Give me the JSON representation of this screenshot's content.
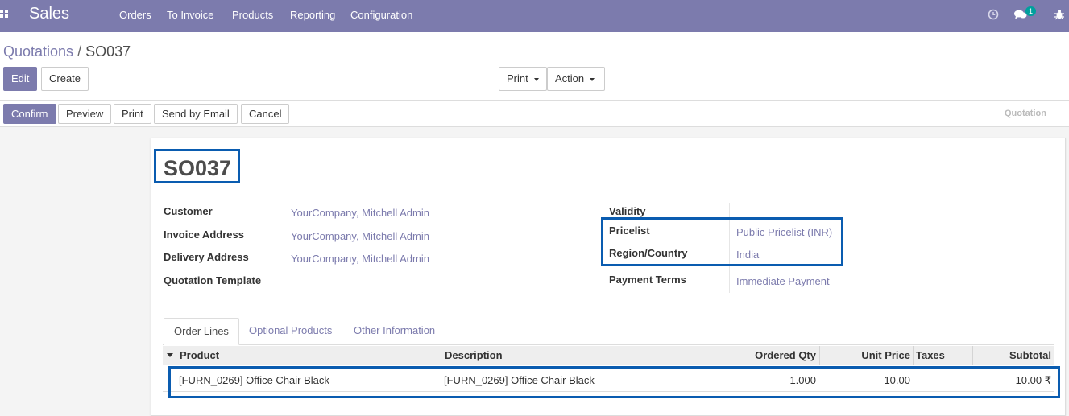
{
  "navbar": {
    "app_name": "Sales",
    "menu": [
      "Orders",
      "To Invoice",
      "Products",
      "Reporting",
      "Configuration"
    ],
    "icons": [
      "apps-grid-icon",
      "clock-icon",
      "chat-icon",
      "bug-icon"
    ],
    "chat_badge": "1",
    "color": "#7c7bad"
  },
  "breadcrumb": {
    "parent": "Quotations",
    "separator": "/",
    "current": "SO037"
  },
  "control_panel": {
    "edit": "Edit",
    "create": "Create",
    "print": "Print",
    "action": "Action"
  },
  "statusbar": {
    "buttons": [
      "Confirm",
      "Preview",
      "Print",
      "Send by Email",
      "Cancel"
    ],
    "stage": "Quotation"
  },
  "form": {
    "name": "SO037",
    "left": {
      "customer_label": "Customer",
      "customer_value": "YourCompany, Mitchell Admin",
      "invoice_label": "Invoice Address",
      "invoice_value": "YourCompany, Mitchell Admin",
      "delivery_label": "Delivery Address",
      "delivery_value": "YourCompany, Mitchell Admin",
      "template_label": "Quotation Template"
    },
    "right": {
      "validity_label": "Validity",
      "pricelist_label": "Pricelist",
      "pricelist_value": "Public Pricelist (INR)",
      "region_label": "Region/Country",
      "region_value": "India",
      "terms_label": "Payment Terms",
      "terms_value": "Immediate Payment"
    }
  },
  "tabs": [
    "Order Lines",
    "Optional Products",
    "Other Information"
  ],
  "order_lines": {
    "columns": [
      "Product",
      "Description",
      "Ordered Qty",
      "Unit Price",
      "Taxes",
      "Subtotal"
    ],
    "rows": [
      {
        "product": "[FURN_0269] Office Chair Black",
        "description": "[FURN_0269] Office Chair Black",
        "qty": "1.000",
        "unit_price": "10.00",
        "taxes": "",
        "subtotal": "10.00 ₹"
      }
    ]
  },
  "highlight_color": "#0a5cb0"
}
